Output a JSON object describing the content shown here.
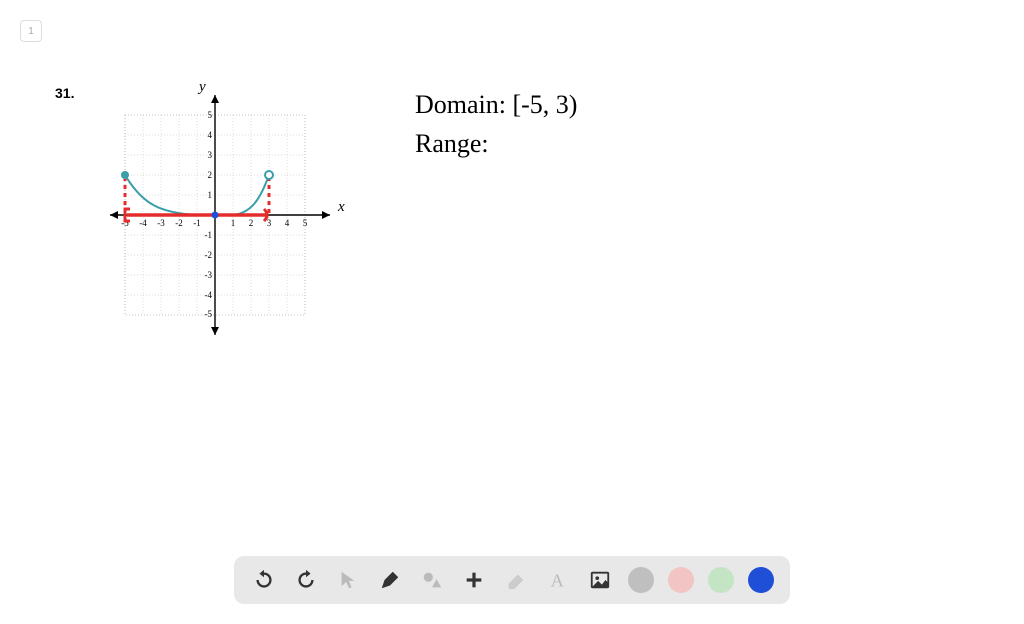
{
  "page_indicator": "1",
  "problem_number": "31.",
  "axis_labels": {
    "y": "y",
    "x": "x"
  },
  "handwriting": {
    "line1": "Domain: [-5, 3)",
    "line2": "Range:"
  },
  "chart_data": {
    "type": "line",
    "title": "",
    "xlabel": "x",
    "ylabel": "y",
    "xlim": [
      -6,
      6
    ],
    "ylim": [
      -6,
      6
    ],
    "x_ticks": [
      -5,
      -4,
      -3,
      -2,
      -1,
      1,
      2,
      3,
      4,
      5
    ],
    "y_ticks": [
      -5,
      -4,
      -3,
      -2,
      -1,
      1,
      2,
      3,
      4,
      5
    ],
    "series": [
      {
        "name": "function-curve",
        "color": "#3a9ea8",
        "x": [
          -5,
          -4,
          -3,
          -2,
          -1,
          0,
          1,
          2,
          3
        ],
        "y": [
          2,
          0.7,
          0.2,
          0.05,
          0,
          0,
          0,
          0.5,
          2
        ]
      },
      {
        "name": "domain-marker",
        "color": "#e52c2c",
        "x": [
          -5,
          -4,
          -3,
          -2,
          -1,
          0,
          1,
          2,
          3
        ],
        "y": [
          0,
          0,
          0,
          0,
          0,
          0,
          0,
          0,
          0
        ]
      }
    ],
    "endpoints": [
      {
        "x": -5,
        "y": 2,
        "closed": true,
        "color": "#3a9ea8"
      },
      {
        "x": 3,
        "y": 2,
        "closed": false,
        "color": "#3a9ea8"
      }
    ],
    "brackets": [
      {
        "x": -5,
        "type": "closed",
        "color": "#e52c2c"
      },
      {
        "x": 3,
        "type": "open",
        "color": "#e52c2c"
      }
    ]
  },
  "toolbar": {
    "tools": {
      "undo": "undo-icon",
      "redo": "redo-icon",
      "pointer": "pointer-icon",
      "pen": "pen-icon",
      "shapes": "shapes-icon",
      "plus": "plus-icon",
      "eraser": "eraser-icon",
      "text": "text-icon",
      "image": "image-icon"
    },
    "colors": {
      "grey": "#bfbfbf",
      "pink": "#f3c4c4",
      "green": "#c4e5c4",
      "blue": "#1f4fd6"
    }
  }
}
